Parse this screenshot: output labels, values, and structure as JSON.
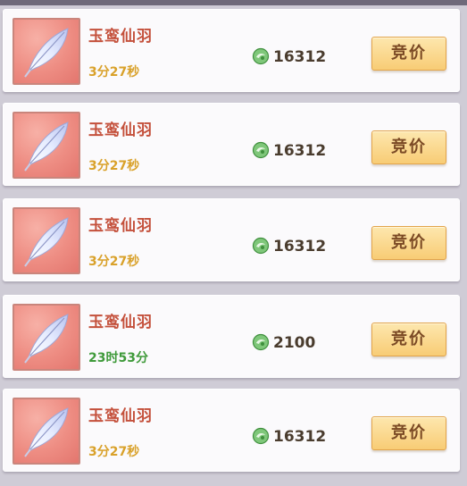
{
  "auction_list": {
    "items": [
      {
        "name": "玉鸾仙羽",
        "time_left": "3分27秒",
        "timer_color": "#d9a12a",
        "price": "16312",
        "bid_label": "竞价",
        "icon": "feather-icon"
      },
      {
        "name": "玉鸾仙羽",
        "time_left": "3分27秒",
        "timer_color": "#d9a12a",
        "price": "16312",
        "bid_label": "竞价",
        "icon": "feather-icon"
      },
      {
        "name": "玉鸾仙羽",
        "time_left": "3分27秒",
        "timer_color": "#d9a12a",
        "price": "16312",
        "bid_label": "竞价",
        "icon": "feather-icon"
      },
      {
        "name": "玉鸾仙羽",
        "time_left": "23时53分",
        "timer_color": "#3f9a3a",
        "price": "2100",
        "bid_label": "竞价",
        "icon": "feather-icon"
      },
      {
        "name": "玉鸾仙羽",
        "time_left": "3分27秒",
        "timer_color": "#d9a12a",
        "price": "16312",
        "bid_label": "竞价",
        "icon": "feather-icon"
      }
    ],
    "currency_icon": "jade-coin-icon",
    "colors": {
      "name": "#c4503b",
      "price": "#4a3c2e",
      "button_bg": "#f8cc75",
      "button_text": "#7b4a25"
    }
  }
}
